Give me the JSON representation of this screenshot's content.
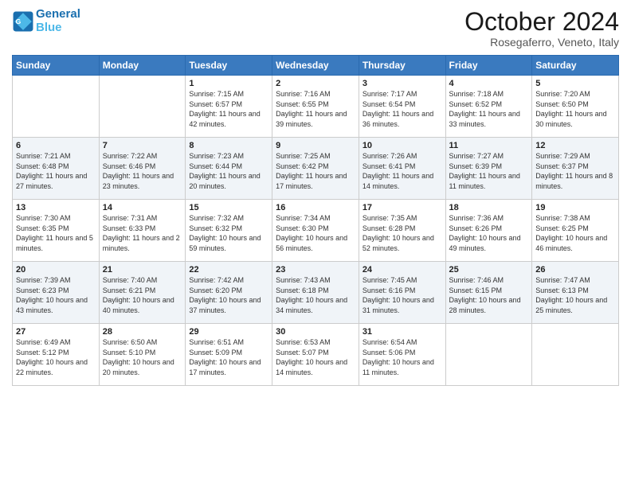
{
  "header": {
    "logo_line1": "General",
    "logo_line2": "Blue",
    "month": "October 2024",
    "location": "Rosegaferro, Veneto, Italy"
  },
  "days_of_week": [
    "Sunday",
    "Monday",
    "Tuesday",
    "Wednesday",
    "Thursday",
    "Friday",
    "Saturday"
  ],
  "weeks": [
    [
      {
        "day": "",
        "info": ""
      },
      {
        "day": "",
        "info": ""
      },
      {
        "day": "1",
        "info": "Sunrise: 7:15 AM\nSunset: 6:57 PM\nDaylight: 11 hours and 42 minutes."
      },
      {
        "day": "2",
        "info": "Sunrise: 7:16 AM\nSunset: 6:55 PM\nDaylight: 11 hours and 39 minutes."
      },
      {
        "day": "3",
        "info": "Sunrise: 7:17 AM\nSunset: 6:54 PM\nDaylight: 11 hours and 36 minutes."
      },
      {
        "day": "4",
        "info": "Sunrise: 7:18 AM\nSunset: 6:52 PM\nDaylight: 11 hours and 33 minutes."
      },
      {
        "day": "5",
        "info": "Sunrise: 7:20 AM\nSunset: 6:50 PM\nDaylight: 11 hours and 30 minutes."
      }
    ],
    [
      {
        "day": "6",
        "info": "Sunrise: 7:21 AM\nSunset: 6:48 PM\nDaylight: 11 hours and 27 minutes."
      },
      {
        "day": "7",
        "info": "Sunrise: 7:22 AM\nSunset: 6:46 PM\nDaylight: 11 hours and 23 minutes."
      },
      {
        "day": "8",
        "info": "Sunrise: 7:23 AM\nSunset: 6:44 PM\nDaylight: 11 hours and 20 minutes."
      },
      {
        "day": "9",
        "info": "Sunrise: 7:25 AM\nSunset: 6:42 PM\nDaylight: 11 hours and 17 minutes."
      },
      {
        "day": "10",
        "info": "Sunrise: 7:26 AM\nSunset: 6:41 PM\nDaylight: 11 hours and 14 minutes."
      },
      {
        "day": "11",
        "info": "Sunrise: 7:27 AM\nSunset: 6:39 PM\nDaylight: 11 hours and 11 minutes."
      },
      {
        "day": "12",
        "info": "Sunrise: 7:29 AM\nSunset: 6:37 PM\nDaylight: 11 hours and 8 minutes."
      }
    ],
    [
      {
        "day": "13",
        "info": "Sunrise: 7:30 AM\nSunset: 6:35 PM\nDaylight: 11 hours and 5 minutes."
      },
      {
        "day": "14",
        "info": "Sunrise: 7:31 AM\nSunset: 6:33 PM\nDaylight: 11 hours and 2 minutes."
      },
      {
        "day": "15",
        "info": "Sunrise: 7:32 AM\nSunset: 6:32 PM\nDaylight: 10 hours and 59 minutes."
      },
      {
        "day": "16",
        "info": "Sunrise: 7:34 AM\nSunset: 6:30 PM\nDaylight: 10 hours and 56 minutes."
      },
      {
        "day": "17",
        "info": "Sunrise: 7:35 AM\nSunset: 6:28 PM\nDaylight: 10 hours and 52 minutes."
      },
      {
        "day": "18",
        "info": "Sunrise: 7:36 AM\nSunset: 6:26 PM\nDaylight: 10 hours and 49 minutes."
      },
      {
        "day": "19",
        "info": "Sunrise: 7:38 AM\nSunset: 6:25 PM\nDaylight: 10 hours and 46 minutes."
      }
    ],
    [
      {
        "day": "20",
        "info": "Sunrise: 7:39 AM\nSunset: 6:23 PM\nDaylight: 10 hours and 43 minutes."
      },
      {
        "day": "21",
        "info": "Sunrise: 7:40 AM\nSunset: 6:21 PM\nDaylight: 10 hours and 40 minutes."
      },
      {
        "day": "22",
        "info": "Sunrise: 7:42 AM\nSunset: 6:20 PM\nDaylight: 10 hours and 37 minutes."
      },
      {
        "day": "23",
        "info": "Sunrise: 7:43 AM\nSunset: 6:18 PM\nDaylight: 10 hours and 34 minutes."
      },
      {
        "day": "24",
        "info": "Sunrise: 7:45 AM\nSunset: 6:16 PM\nDaylight: 10 hours and 31 minutes."
      },
      {
        "day": "25",
        "info": "Sunrise: 7:46 AM\nSunset: 6:15 PM\nDaylight: 10 hours and 28 minutes."
      },
      {
        "day": "26",
        "info": "Sunrise: 7:47 AM\nSunset: 6:13 PM\nDaylight: 10 hours and 25 minutes."
      }
    ],
    [
      {
        "day": "27",
        "info": "Sunrise: 6:49 AM\nSunset: 5:12 PM\nDaylight: 10 hours and 22 minutes."
      },
      {
        "day": "28",
        "info": "Sunrise: 6:50 AM\nSunset: 5:10 PM\nDaylight: 10 hours and 20 minutes."
      },
      {
        "day": "29",
        "info": "Sunrise: 6:51 AM\nSunset: 5:09 PM\nDaylight: 10 hours and 17 minutes."
      },
      {
        "day": "30",
        "info": "Sunrise: 6:53 AM\nSunset: 5:07 PM\nDaylight: 10 hours and 14 minutes."
      },
      {
        "day": "31",
        "info": "Sunrise: 6:54 AM\nSunset: 5:06 PM\nDaylight: 10 hours and 11 minutes."
      },
      {
        "day": "",
        "info": ""
      },
      {
        "day": "",
        "info": ""
      }
    ]
  ]
}
